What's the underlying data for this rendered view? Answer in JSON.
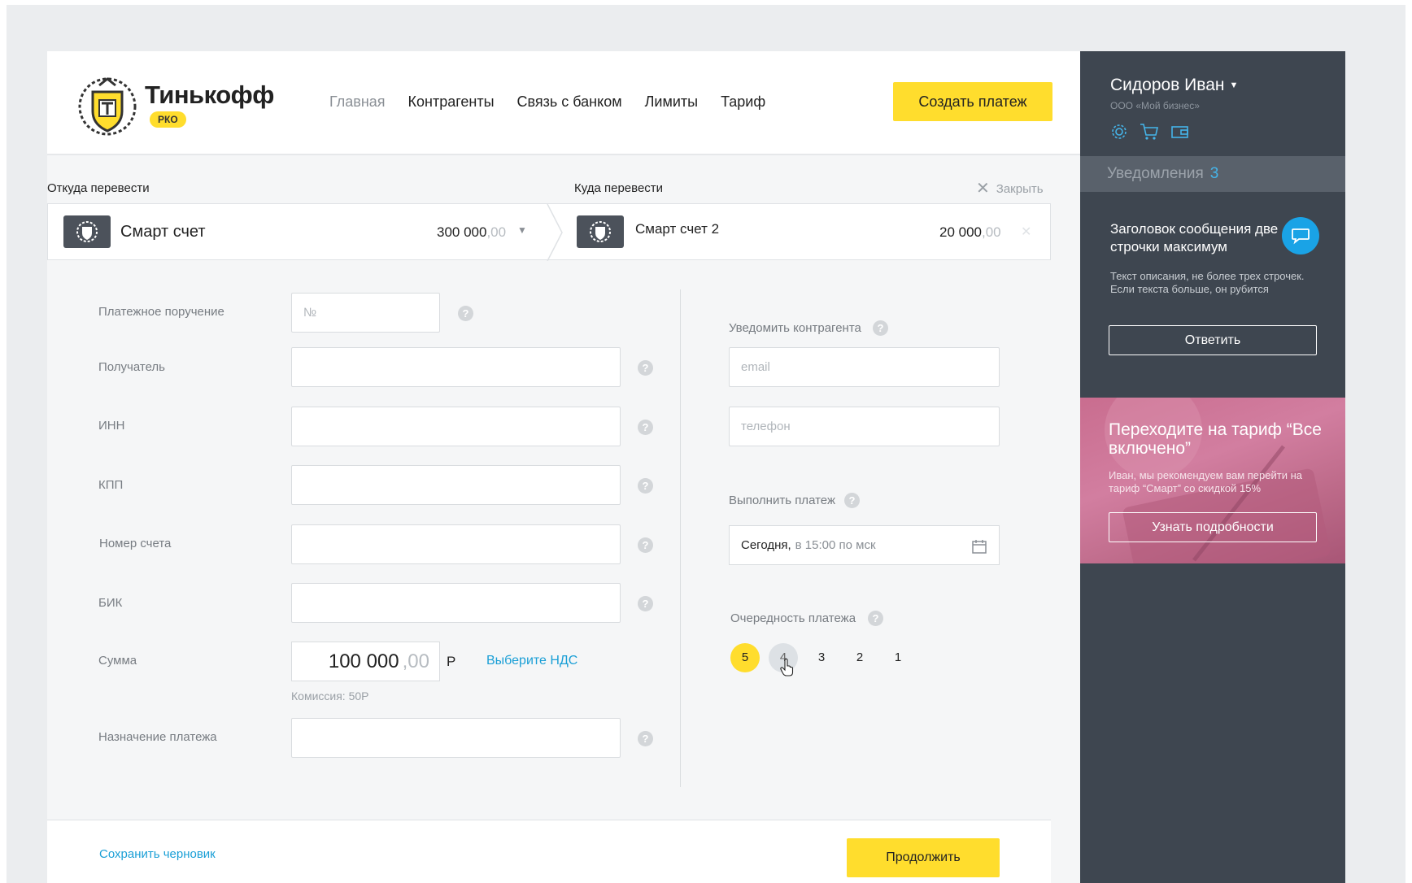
{
  "header": {
    "brand": "Тинькофф",
    "badge": "РКО",
    "nav": [
      "Главная",
      "Контрагенты",
      "Связь с банком",
      "Лимиты",
      "Тариф"
    ],
    "create_button": "Создать платеж"
  },
  "transfer": {
    "from_label": "Откуда перевести",
    "to_label": "Куда перевести",
    "close_label": "Закрыть",
    "from_account": {
      "name": "Смарт счет",
      "amount_int": "300 000",
      "amount_dec": ",00"
    },
    "to_account": {
      "name": "Смарт счет 2",
      "amount_int": "20 000",
      "amount_dec": ",00"
    }
  },
  "form": {
    "order_label": "Платежное поручение",
    "order_placeholder": "№",
    "recipient_label": "Получатель",
    "inn_label": "ИНН",
    "kpp_label": "КПП",
    "account_label": "Номер счета",
    "bik_label": "БИК",
    "sum_label": "Сумма",
    "sum_int": "100 000",
    "sum_dec": ",00",
    "currency": "Р",
    "vat_link": "Выберите НДС",
    "commission": "Комиссия: 50Р",
    "purpose_label": "Назначение платежа",
    "notify_label": "Уведомить контрагента",
    "email_placeholder": "email",
    "phone_placeholder": "телефон",
    "execute_label": "Выполнить платеж",
    "date_strong": "Сегодня,",
    "date_rest": "в 15:00 по мск",
    "priority_label": "Очередность платежа",
    "priority_options": [
      "5",
      "4",
      "3",
      "2",
      "1"
    ],
    "priority_selected": "5"
  },
  "footer": {
    "draft_link": "Сохранить черновик",
    "continue_button": "Продолжить"
  },
  "sidebar": {
    "user_name": "Сидоров Иван",
    "user_org": "ООО «Мой бизнес»",
    "notifications_label": "Уведомления",
    "notifications_count": "3",
    "message_title": "Заголовок сообщения две строчки максимум",
    "message_text": "Текст описания, не более трех строчек. Если текста больше, он рубится",
    "reply_button": "Ответить",
    "promo_title": "Переходите на тариф “Все включено”",
    "promo_text": "Иван, мы рекомендуем вам перейти на тариф “Смарт” со скидкой 15%",
    "promo_button": "Узнать подробности"
  },
  "colors": {
    "accent": "#ffdd2d",
    "link": "#1a9fd6",
    "sidebar": "#3e4650",
    "promo": "#c96d8f"
  }
}
